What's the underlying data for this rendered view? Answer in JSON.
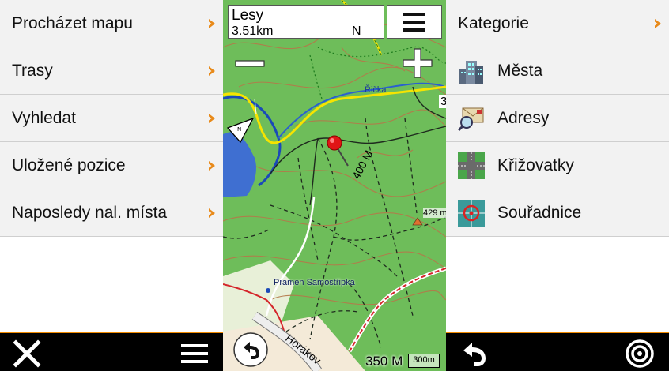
{
  "left_menu": {
    "items": [
      {
        "label": "Procházet mapu"
      },
      {
        "label": "Trasy"
      },
      {
        "label": "Vyhledat"
      },
      {
        "label": "Uložené pozice"
      },
      {
        "label": "Naposledy nal. místa"
      }
    ]
  },
  "map": {
    "info_title": "Lesy",
    "info_distance": "3.51km",
    "info_heading": "N",
    "labels": {
      "river": "Řička",
      "elevation_contour": "400 M",
      "summit": "429 m",
      "spring": "Pramen Samostřipka",
      "road": "Horákov",
      "edge_number": "3"
    },
    "scale_text": "350 M",
    "scale_bar": "300m"
  },
  "categories": {
    "header": "Kategorie",
    "items": [
      {
        "label": "Města",
        "icon": "city-icon"
      },
      {
        "label": "Adresy",
        "icon": "address-icon"
      },
      {
        "label": "Křižovatky",
        "icon": "intersection-icon"
      },
      {
        "label": "Souřadnice",
        "icon": "coordinates-icon"
      }
    ]
  },
  "colors": {
    "accent": "#f08a00",
    "chevron": "#e88a1a",
    "map_forest": "#6ebd5a",
    "bottom_bar": "#000000"
  }
}
